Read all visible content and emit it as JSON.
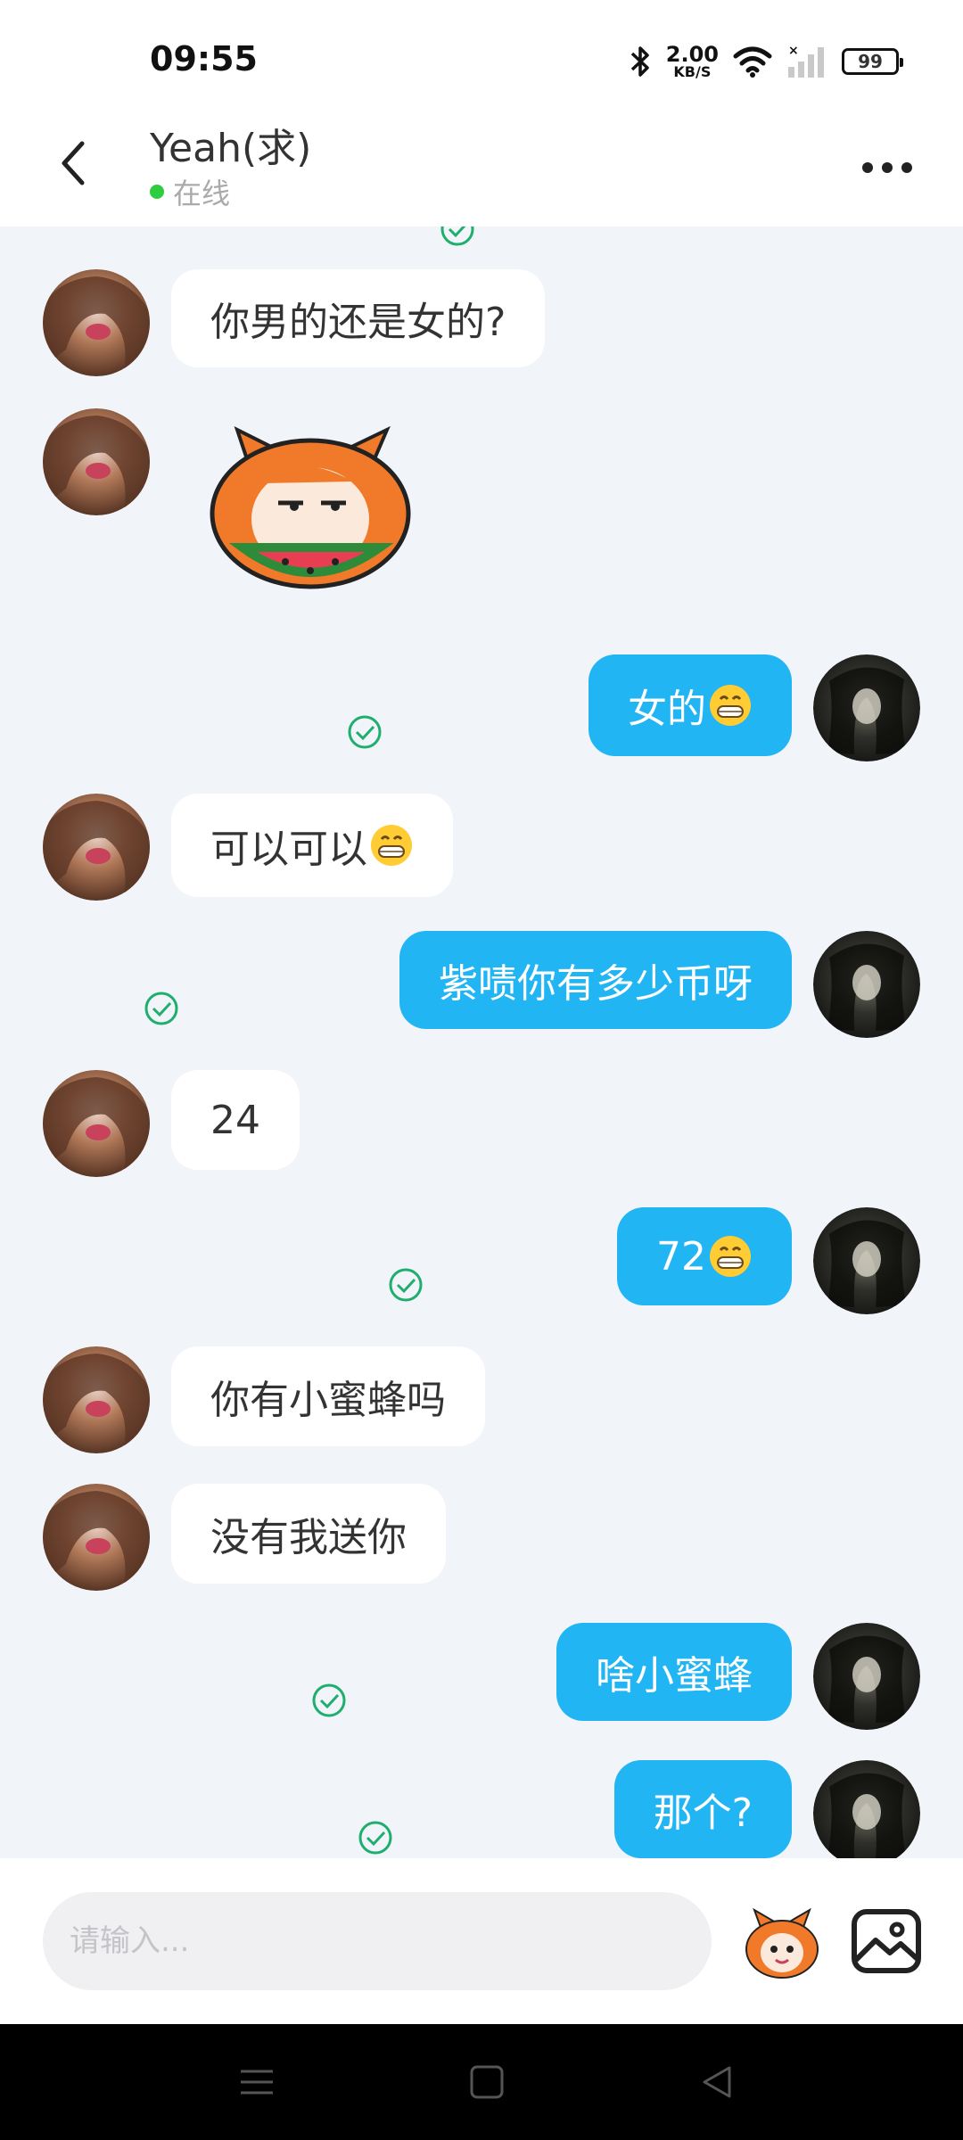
{
  "status_bar": {
    "time": "09:55",
    "net_speed": "2.00",
    "net_unit": "KB/S",
    "battery": "99",
    "icons": [
      "bluetooth-icon",
      "wifi-icon",
      "signal-icon",
      "battery-icon"
    ]
  },
  "header": {
    "title": "Yeah(求)",
    "presence": "在线",
    "presence_color": "#2ecc40",
    "icons": [
      "back-arrow-icon",
      "more-dots-icon"
    ]
  },
  "messages": [
    {
      "side": "in",
      "type": "text",
      "text": "你男的还是女的?"
    },
    {
      "side": "in",
      "type": "sticker",
      "sticker": "watermelon-cat-sticker"
    },
    {
      "side": "out",
      "type": "text",
      "text": "女的",
      "emoji": "grin-emoji",
      "status": "sent"
    },
    {
      "side": "in",
      "type": "text",
      "text": "可以可以",
      "emoji": "grin-emoji"
    },
    {
      "side": "out",
      "type": "text",
      "text": "紫啧你有多少币呀",
      "status": "sent"
    },
    {
      "side": "in",
      "type": "text",
      "text": "24"
    },
    {
      "side": "out",
      "type": "text",
      "text": "72",
      "emoji": "grin-emoji",
      "status": "sent"
    },
    {
      "side": "in",
      "type": "text",
      "text": "你有小蜜蜂吗"
    },
    {
      "side": "in",
      "type": "text",
      "text": "没有我送你"
    },
    {
      "side": "out",
      "type": "text",
      "text": "啥小蜜蜂",
      "status": "sent"
    },
    {
      "side": "out",
      "type": "text",
      "text": "那个?",
      "status": "sent"
    }
  ],
  "input": {
    "placeholder": "请输入..."
  },
  "colors": {
    "outgoing_bubble": "#22b5f4",
    "incoming_bubble": "#ffffff",
    "background": "#f1f4f9",
    "check": "#1fae6e"
  }
}
